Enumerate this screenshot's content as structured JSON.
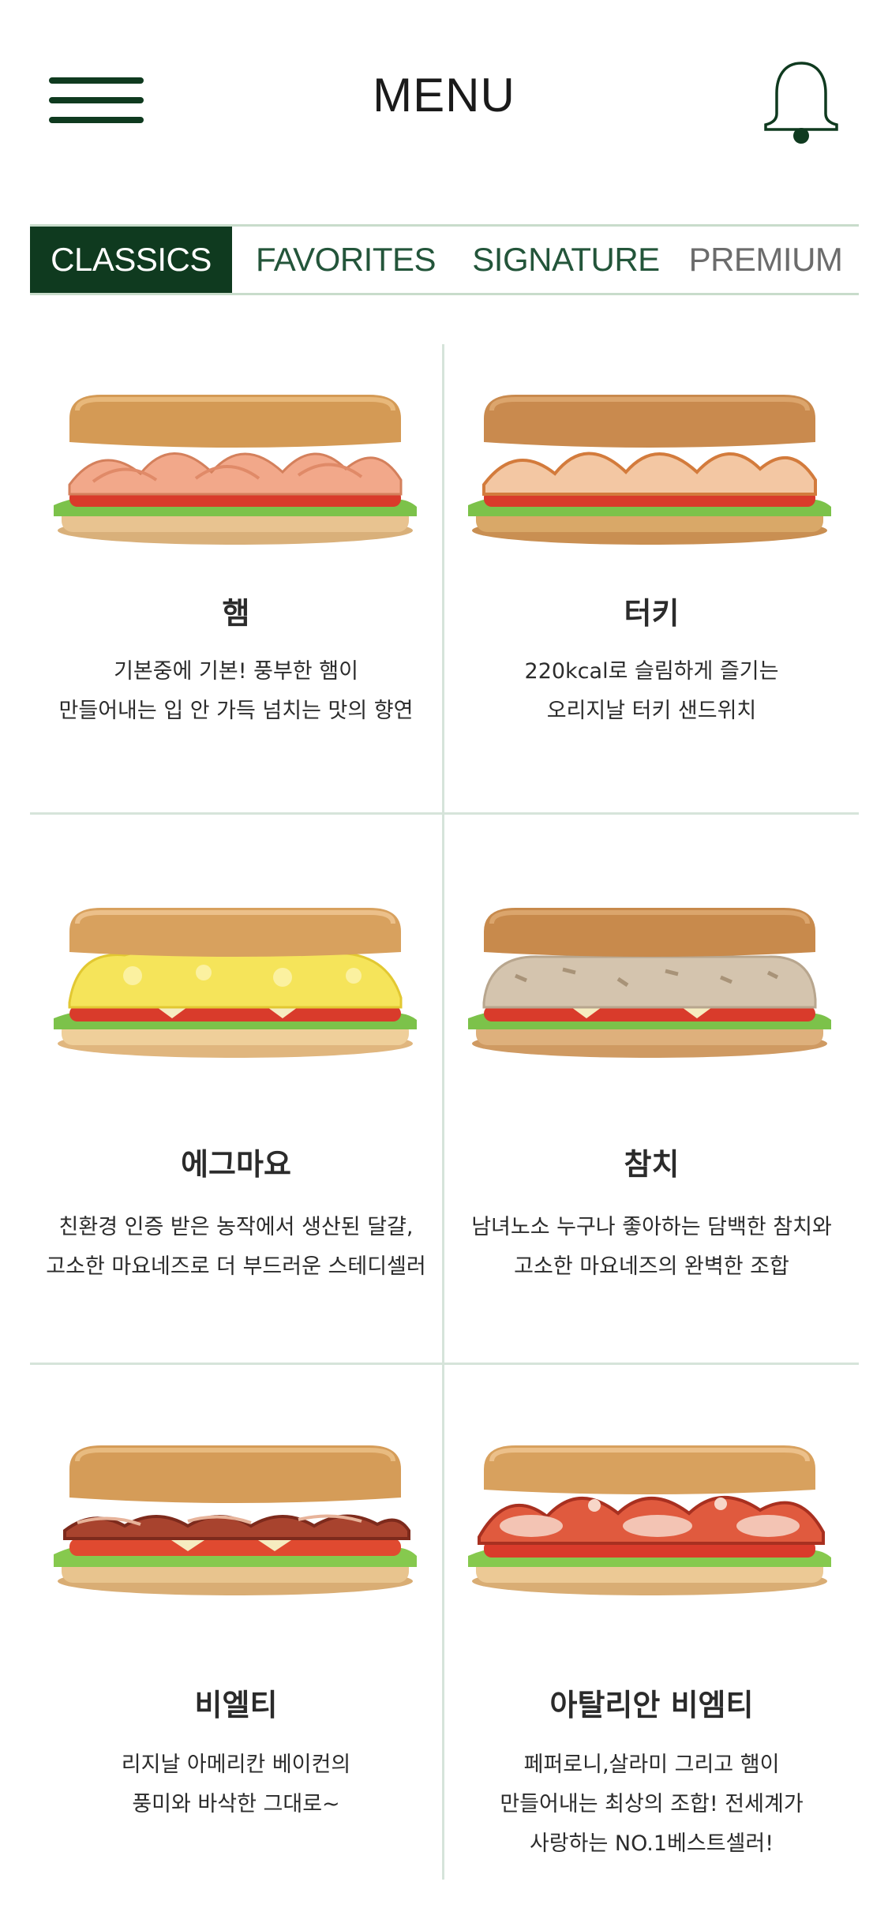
{
  "header": {
    "title": "MENU"
  },
  "tabs": [
    {
      "label": "CLASSICS",
      "active": true
    },
    {
      "label": "FAVORITES",
      "active": false
    },
    {
      "label": "SIGNATURE",
      "active": false
    },
    {
      "label": "PREMIUM",
      "active": false
    }
  ],
  "colors": {
    "brand_dark_green": "#0f3a1f",
    "tab_text_green": "#23553a",
    "divider": "#d6e4da"
  },
  "menu": [
    {
      "name": "햄",
      "desc1": "기본중에 기본! 풍부한 햄이",
      "desc2": "만들어내는 입 안 가득 넘치는 맛의 향연",
      "desc3": "",
      "filling": "ham"
    },
    {
      "name": "터키",
      "desc1": "220kcal로 슬림하게 즐기는",
      "desc2": "오리지날 터키 샌드위치",
      "desc3": "",
      "filling": "turkey"
    },
    {
      "name": "에그마요",
      "desc1": "친환경 인증 받은 농작에서 생산된 달걀,",
      "desc2": "고소한 마요네즈로 더 부드러운 스테디셀러",
      "desc3": "",
      "filling": "egg"
    },
    {
      "name": "참치",
      "desc1": "남녀노소 누구나 좋아하는 담백한 참치와",
      "desc2": "고소한 마요네즈의 완벽한 조합",
      "desc3": "",
      "filling": "tuna"
    },
    {
      "name": "비엘티",
      "desc1": "리지날 아메리칸 베이컨의",
      "desc2": "풍미와 바삭한 그대로~",
      "desc3": "",
      "filling": "bacon"
    },
    {
      "name": "아탈리안 비엠티",
      "desc1": "페퍼로니,살라미 그리고 햄이",
      "desc2": "만들어내는 최상의 조합! 전세계가",
      "desc3": "사랑하는 NO.1베스트셀러!",
      "filling": "bmt"
    }
  ]
}
